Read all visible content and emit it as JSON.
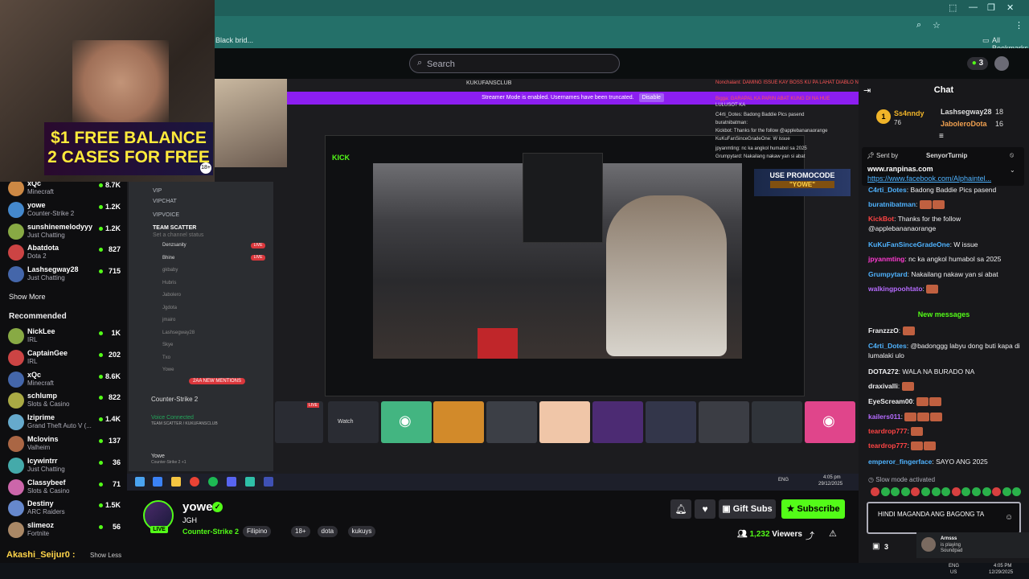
{
  "browser": {
    "bookmark_black": "Black brid...",
    "all_bookmarks": "All Bookmarks",
    "win_min": "—",
    "win_max": "❐",
    "win_close": "✕"
  },
  "header": {
    "search_placeholder": "Search",
    "notification_count": "3"
  },
  "webcam_promo": {
    "line1": "$1 FREE BALANCE",
    "line2": "2 CASES FOR FREE",
    "age_badge": "18+"
  },
  "sidebar": {
    "following": [
      {
        "name": "xQc",
        "category": "Minecraft",
        "viewers": "8.7K"
      },
      {
        "name": "yowe",
        "category": "Counter-Strike 2",
        "viewers": "1.2K"
      },
      {
        "name": "sunshinemelodyyy",
        "category": "Just Chatting",
        "viewers": "1.2K"
      },
      {
        "name": "Abatdota",
        "category": "Dota 2",
        "viewers": "827"
      },
      {
        "name": "Lashsegway28",
        "category": "Just Chatting",
        "viewers": "715"
      }
    ],
    "show_more": "Show More",
    "recommended_title": "Recommended",
    "recommended": [
      {
        "name": "NickLee",
        "category": "IRL",
        "viewers": "1K"
      },
      {
        "name": "CaptainGee",
        "category": "IRL",
        "viewers": "202"
      },
      {
        "name": "xQc",
        "category": "Minecraft",
        "viewers": "8.6K"
      },
      {
        "name": "schlump",
        "category": "Slots & Casino",
        "viewers": "822"
      },
      {
        "name": "Iziprime",
        "category": "Grand Theft Auto V (...",
        "viewers": "1.4K"
      },
      {
        "name": "Mclovins",
        "category": "Valheim",
        "viewers": "137"
      },
      {
        "name": "Icywintrr",
        "category": "Just Chatting",
        "viewers": "36"
      },
      {
        "name": "Classybeef",
        "category": "Slots & Casino",
        "viewers": "71"
      },
      {
        "name": "Destiny",
        "category": "ARC Raiders",
        "viewers": "1.5K"
      },
      {
        "name": "slimeoz",
        "category": "Fortnite",
        "viewers": "56"
      }
    ],
    "show_less": "Show Less",
    "overlay_user": "Akashi_Seijur0 :"
  },
  "discord": {
    "channels": [
      "VIP",
      "VIPCHAT",
      "VIPVOICE",
      "TEAM SCATTER",
      "Set a channel status"
    ],
    "members": [
      "Denzsanity",
      "Bhine",
      "gkbaby",
      "Hubris",
      "Jabolero",
      "Jgdota",
      "jmairo",
      "Lashsegway28",
      "Skye",
      "Txo",
      "Yowe"
    ],
    "live_label": "LIVE",
    "mentions": "2AA NEW MENTIONS",
    "game": "Counter-Strike 2",
    "voice_connected": "Voice Connected",
    "voice_channel": "TEAM SCATTER / KUKUFANSCLUB",
    "user": "Yowe",
    "user_status": "Counter-Strike 2 +1"
  },
  "stream_inner": {
    "window_title": "KUKUFANSCLUB",
    "streamer_mode": "Streamer Mode is enabled. Usernames have been truncated.",
    "disable": "Disable",
    "inner_brand": "KICK",
    "promo_a": "USE PROMOCODE",
    "promo_b": "\"YOWE\"",
    "watch": "Watch",
    "overlay_chat": [
      "Nonchalant: DAMING ISSUE KAY BOSS KU PA LAHAT DIABLO NA ARAW",
      "Bigga: GARAPAL KA PARIN ABAT KUNG DI NA HUE",
      "LULUSOT KA",
      "C4rti_Dotes: Badong Baddie Pics pasend",
      "buratnibatman:",
      "Kickbot: Thanks for the follow @applebananaorange",
      "KuKuFanSinceGradeOne: W issue",
      "jpyanmting: nc ka angkol humabol sa 2025",
      "Grumpytard: Nakailang nakaw yan si abat"
    ],
    "clock_time": "4:05 pm",
    "clock_date": "29/12/2025",
    "lang": "ENG"
  },
  "stream_info": {
    "streamer": "yowe",
    "title": "JGH",
    "category": "Counter-Strike 2",
    "tags": [
      "Filipino",
      "18+",
      "dota",
      "kukuys"
    ],
    "live": "LIVE",
    "gift_subs": "Gift Subs",
    "subscribe": "Subscribe",
    "viewers": "1,232",
    "viewers_label": "Viewers"
  },
  "chat": {
    "title": "Chat",
    "top_gifters": [
      {
        "name": "Ss4nndy",
        "count": "76"
      },
      {
        "name": "Lashsegway28",
        "count": "18"
      },
      {
        "name": "JaboleroDota",
        "count": "16"
      }
    ],
    "pinned_sent_by": "Sent by",
    "pinned_user": "SenyorTurnip",
    "pinned_line1": "www.ranpinas.com",
    "pinned_line2": "https://www.facebook.com/Alphaintel...",
    "messages_before": [
      {
        "user": "C4rti_Dotes",
        "text": "Badong Baddie Pics pasend",
        "color": "#4fb3ff"
      },
      {
        "user": "buratnibatman",
        "text": "",
        "color": "#4fb3ff"
      },
      {
        "user": "KickBot",
        "text": "Thanks for the follow @applebananaorange",
        "color": "#ff4444"
      },
      {
        "user": "KuKuFanSinceGradeOne",
        "text": "W issue",
        "color": "#4fb3ff"
      },
      {
        "user": "jpyanmting",
        "text": "nc ka angkol humabol sa 2025",
        "color": "#ff3bd1"
      },
      {
        "user": "Grumpytard",
        "text": "Nakailang nakaw yan si abat",
        "color": "#4fb3ff"
      },
      {
        "user": "walkingpoohtato",
        "text": "",
        "color": "#b66bff"
      }
    ],
    "new_messages": "New messages",
    "messages_after": [
      {
        "user": "FranzzzO",
        "text": "",
        "color": "#efeff1"
      },
      {
        "user": "C4rti_Dotes",
        "text": "@badonggg labyu dong buti kapa di lumalaki ulo",
        "color": "#4fb3ff"
      },
      {
        "user": "DOTA272",
        "text": "WALA NA BURADO NA",
        "color": "#efeff1"
      },
      {
        "user": "draxivalli",
        "text": "",
        "color": "#efeff1"
      },
      {
        "user": "EyeScream00",
        "text": "",
        "color": "#efeff1"
      },
      {
        "user": "kailers011",
        "text": "",
        "color": "#b66bff"
      },
      {
        "user": "teardrop777",
        "text": "",
        "color": "#ff4444"
      },
      {
        "user": "teardrop777",
        "text": "",
        "color": "#ff4444"
      },
      {
        "user": "emperor_fingerface",
        "text": "SAYO ANG 2025",
        "color": "#4fb3ff"
      }
    ],
    "slow_mode": "Slow mode activated",
    "input_value": "HINDI MAGANDA ANG BAGONG TA",
    "bottom_count": "3"
  },
  "toast": {
    "user": "Arnsss",
    "line1": "is playing",
    "line2": "Soundpad"
  },
  "os": {
    "lang": "ENG",
    "region": "US",
    "time": "4:05 PM",
    "date": "12/29/2025"
  }
}
